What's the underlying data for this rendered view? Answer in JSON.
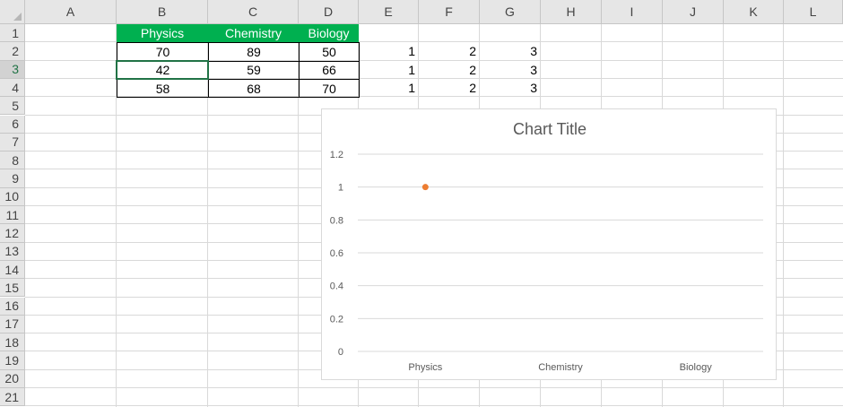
{
  "columns": [
    "A",
    "B",
    "C",
    "D",
    "E",
    "F",
    "G",
    "H",
    "I",
    "J",
    "K",
    "L"
  ],
  "rows": [
    "1",
    "2",
    "3",
    "4",
    "5",
    "6",
    "7",
    "8",
    "9",
    "10",
    "11",
    "12",
    "13",
    "14",
    "15",
    "16",
    "17",
    "18",
    "19",
    "20",
    "21"
  ],
  "table": {
    "headers": [
      "Physics",
      "Chemistry",
      "Biology"
    ],
    "rows": [
      [
        "70",
        "89",
        "50"
      ],
      [
        "42",
        "59",
        "66"
      ],
      [
        "58",
        "68",
        "70"
      ]
    ]
  },
  "extra": [
    [
      "1",
      "2",
      "3"
    ],
    [
      "1",
      "2",
      "3"
    ],
    [
      "1",
      "2",
      "3"
    ]
  ],
  "colors": {
    "header_green": "#00b050",
    "marker": "#ed7d31"
  },
  "chart_data": {
    "type": "scatter",
    "title": "Chart Title",
    "categories": [
      "Physics",
      "Chemistry",
      "Biology"
    ],
    "series": [
      {
        "values": [
          1,
          null,
          null
        ]
      }
    ],
    "yticks": [
      "0",
      "0.2",
      "0.4",
      "0.6",
      "0.8",
      "1",
      "1.2"
    ],
    "ylim": [
      0,
      1.2
    ],
    "grid": true,
    "legend": "none"
  }
}
